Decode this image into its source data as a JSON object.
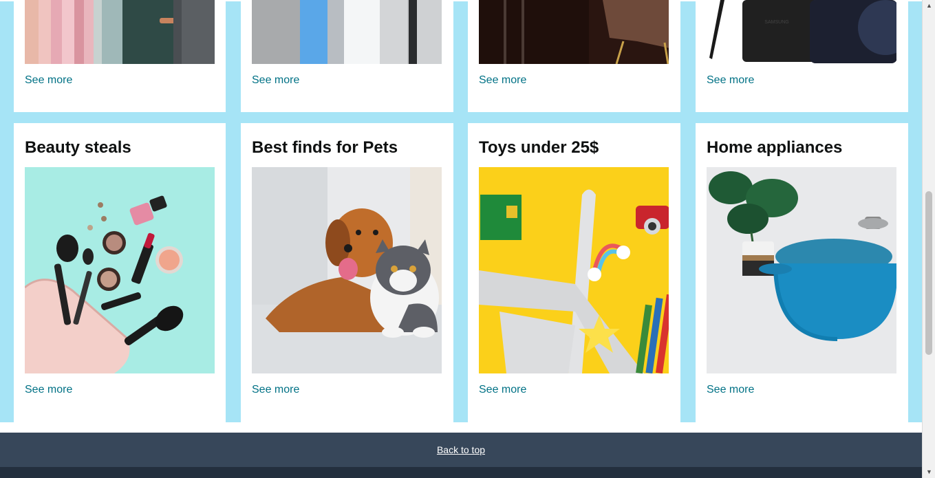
{
  "top_row": [
    {
      "see_more": "See more"
    },
    {
      "see_more": "See more"
    },
    {
      "see_more": "See more"
    },
    {
      "see_more": "See more"
    }
  ],
  "cards": [
    {
      "title": "Beauty steals",
      "see_more": "See more",
      "image": "makeup-products-image"
    },
    {
      "title": "Best finds for Pets",
      "see_more": "See more",
      "image": "dog-and-cat-image"
    },
    {
      "title": "Toys under 25$",
      "see_more": "See more",
      "image": "toy-airplane-image"
    },
    {
      "title": "Home appliances",
      "see_more": "See more",
      "image": "blue-dutch-oven-image"
    }
  ],
  "footer": {
    "back_to_top": "Back to top"
  },
  "colors": {
    "page_bg": "#a6e4f6",
    "link": "#007185",
    "footer": "#37475a",
    "footer_bottom": "#232f3e"
  },
  "scrollbar": {
    "up_icon": "arrow-up-icon",
    "down_icon": "arrow-down-icon"
  }
}
